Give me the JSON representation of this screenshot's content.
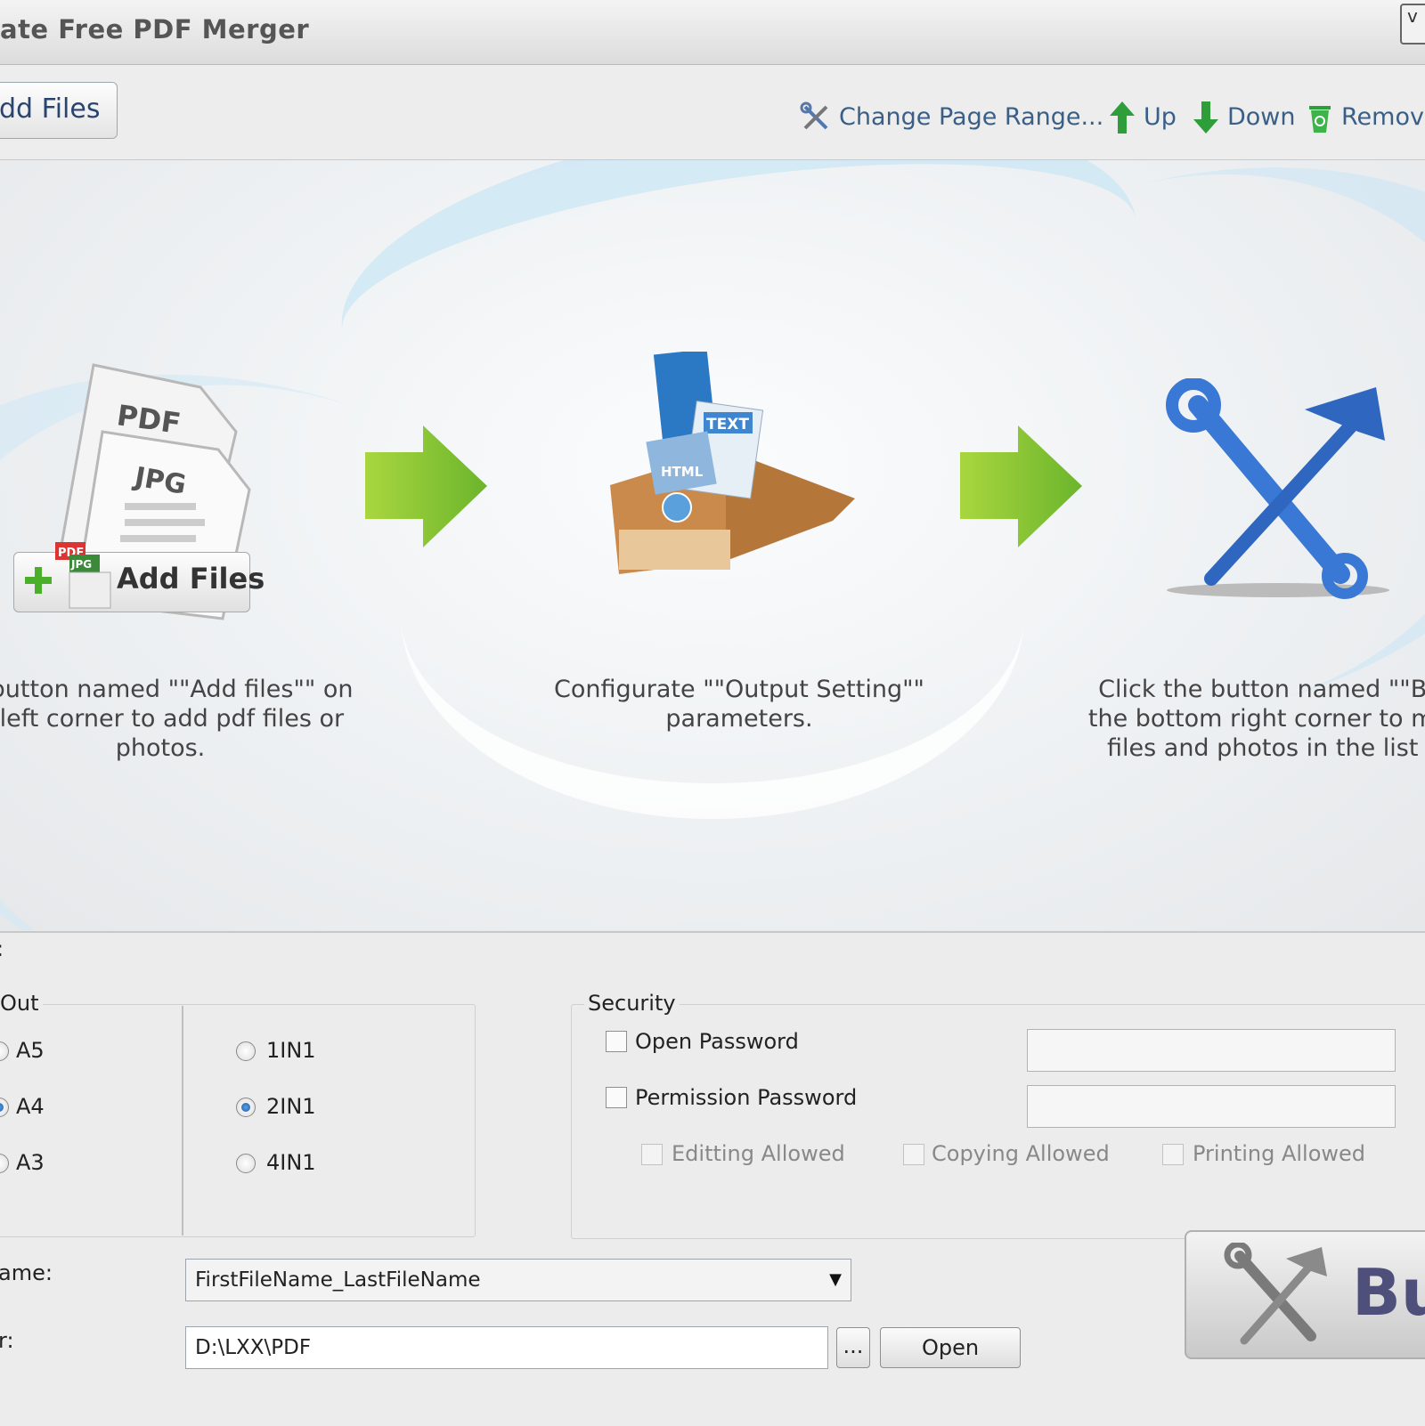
{
  "window": {
    "title": "ate Free PDF Merger",
    "control_glyph": "v"
  },
  "toolbar": {
    "add_files_label": "dd Files",
    "change_page_range_label": "Change Page Range...",
    "up_label": "Up",
    "down_label": "Down",
    "remove_label": "Remov"
  },
  "steps": [
    {
      "image_button_label": "Add Files",
      "badge_pdf": "PDF",
      "badge_jpg": "JPG",
      "page_pdf": "PDF",
      "page_jpg": "JPG",
      "text": [
        "e button named \"\"Add files\"\" on",
        "p left corner to add pdf files or",
        "photos."
      ]
    },
    {
      "badge_text": "TEXT",
      "badge_html": "HTML",
      "text": [
        "Configurate \"\"Output Setting\"\"",
        "parameters."
      ]
    },
    {
      "text": [
        "Click the button named \"\"Bui",
        "the bottom right corner to mer",
        "files and photos in the list v"
      ]
    }
  ],
  "settings": {
    "section_mark": ":",
    "layout_group_label": "Out",
    "page_sizes": [
      {
        "label": "A5",
        "selected": false
      },
      {
        "label": "A4",
        "selected": true
      },
      {
        "label": "A3",
        "selected": false
      }
    ],
    "pages_per_sheet": [
      {
        "label": "1IN1",
        "selected": false
      },
      {
        "label": "2IN1",
        "selected": true
      },
      {
        "label": "4IN1",
        "selected": false
      }
    ],
    "security": {
      "label": "Security",
      "open_password_label": "Open Password",
      "permission_password_label": "Permission Password",
      "editing_label": "Editting Allowed",
      "copying_label": "Copying Allowed",
      "printing_label": "Printing Allowed"
    },
    "file_name_label": "ame:",
    "file_name_value": "FirstFileName_LastFileName",
    "folder_label": "r:",
    "folder_value": "D:\\LXX\\PDF",
    "browse_label": "...",
    "open_label": "Open",
    "build_label": "Bu"
  },
  "colors": {
    "accent": "#3a5f86",
    "arrow_green": "#8cc63f",
    "tool_blue": "#3a78d6"
  }
}
